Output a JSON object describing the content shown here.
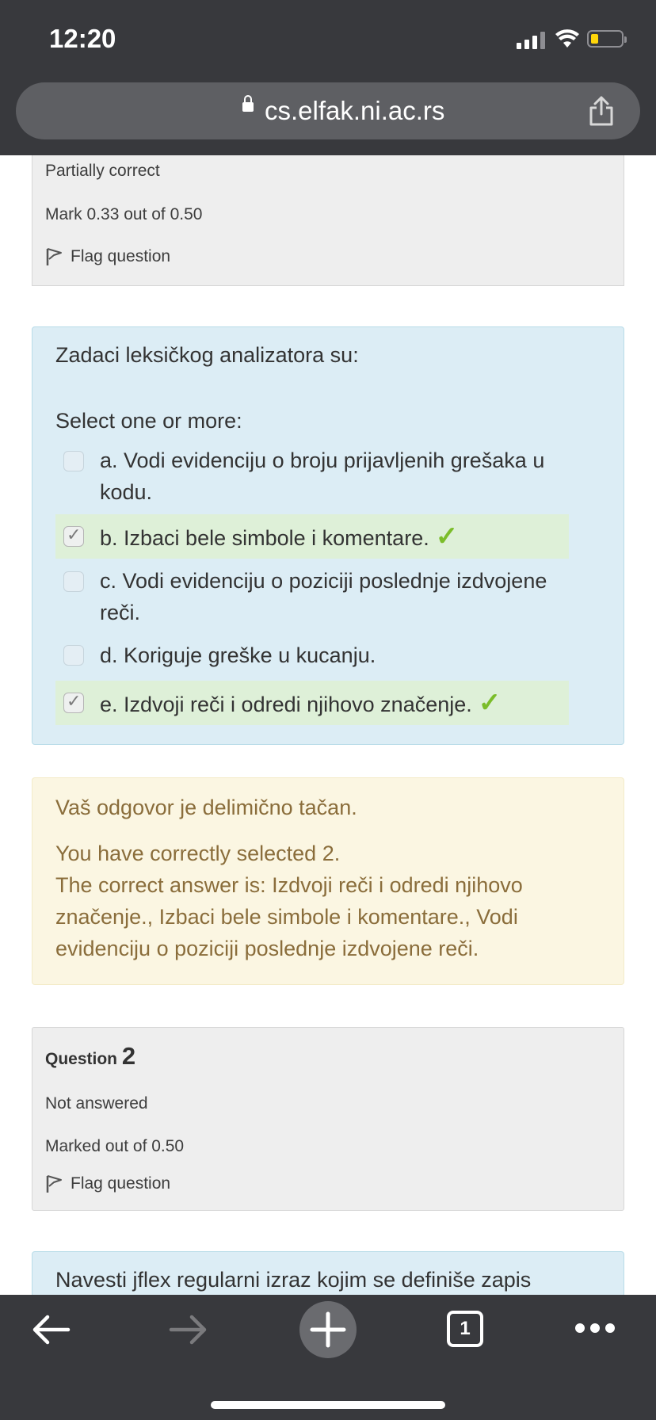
{
  "status": {
    "time": "12:20"
  },
  "browser": {
    "url": "cs.elfak.ni.ac.rs"
  },
  "prev_question_info": {
    "state": "Partially correct",
    "mark": "Mark 0.33 out of 0.50",
    "flag_label": "Flag question"
  },
  "question1": {
    "prompt": "Zadaci leksičkog analizatora su:",
    "select_label": "Select one or more:",
    "options": [
      {
        "text": "a. Vodi evidenciju o broju prijavljenih grešaka u kodu.",
        "checked": false,
        "correct": false
      },
      {
        "text": "b. Izbaci bele simbole i komentare.",
        "checked": true,
        "correct": true
      },
      {
        "text": "c. Vodi evidenciju o poziciji poslednje izdvojene reči.",
        "checked": false,
        "correct": false
      },
      {
        "text": "d. Koriguje greške u kucanju.",
        "checked": false,
        "correct": false
      },
      {
        "text": "e. Izdvoji reči i odredi njihovo značenje.",
        "checked": true,
        "correct": true
      }
    ]
  },
  "feedback": {
    "line1": "Vaš odgovor je delimično tačan.",
    "line2": "You have correctly selected 2.",
    "line3": "The correct answer is: Izdvoji reči i odredi njihovo značenje., Izbaci bele simbole i komentare., Vodi evidenciju o poziciji poslednje izdvojene reči."
  },
  "question2_info": {
    "label": "Question",
    "number": "2",
    "state": "Not answered",
    "mark": "Marked out of 0.50",
    "flag_label": "Flag question"
  },
  "question2": {
    "prompt": "Navesti jflex regularni izraz kojim se definiše zapis"
  },
  "toolbar": {
    "tab_count": "1"
  },
  "colors": {
    "accent_correct": "#7bbd2a",
    "feedback_text": "#8a6d3b",
    "question_bg": "#dcedf5"
  }
}
